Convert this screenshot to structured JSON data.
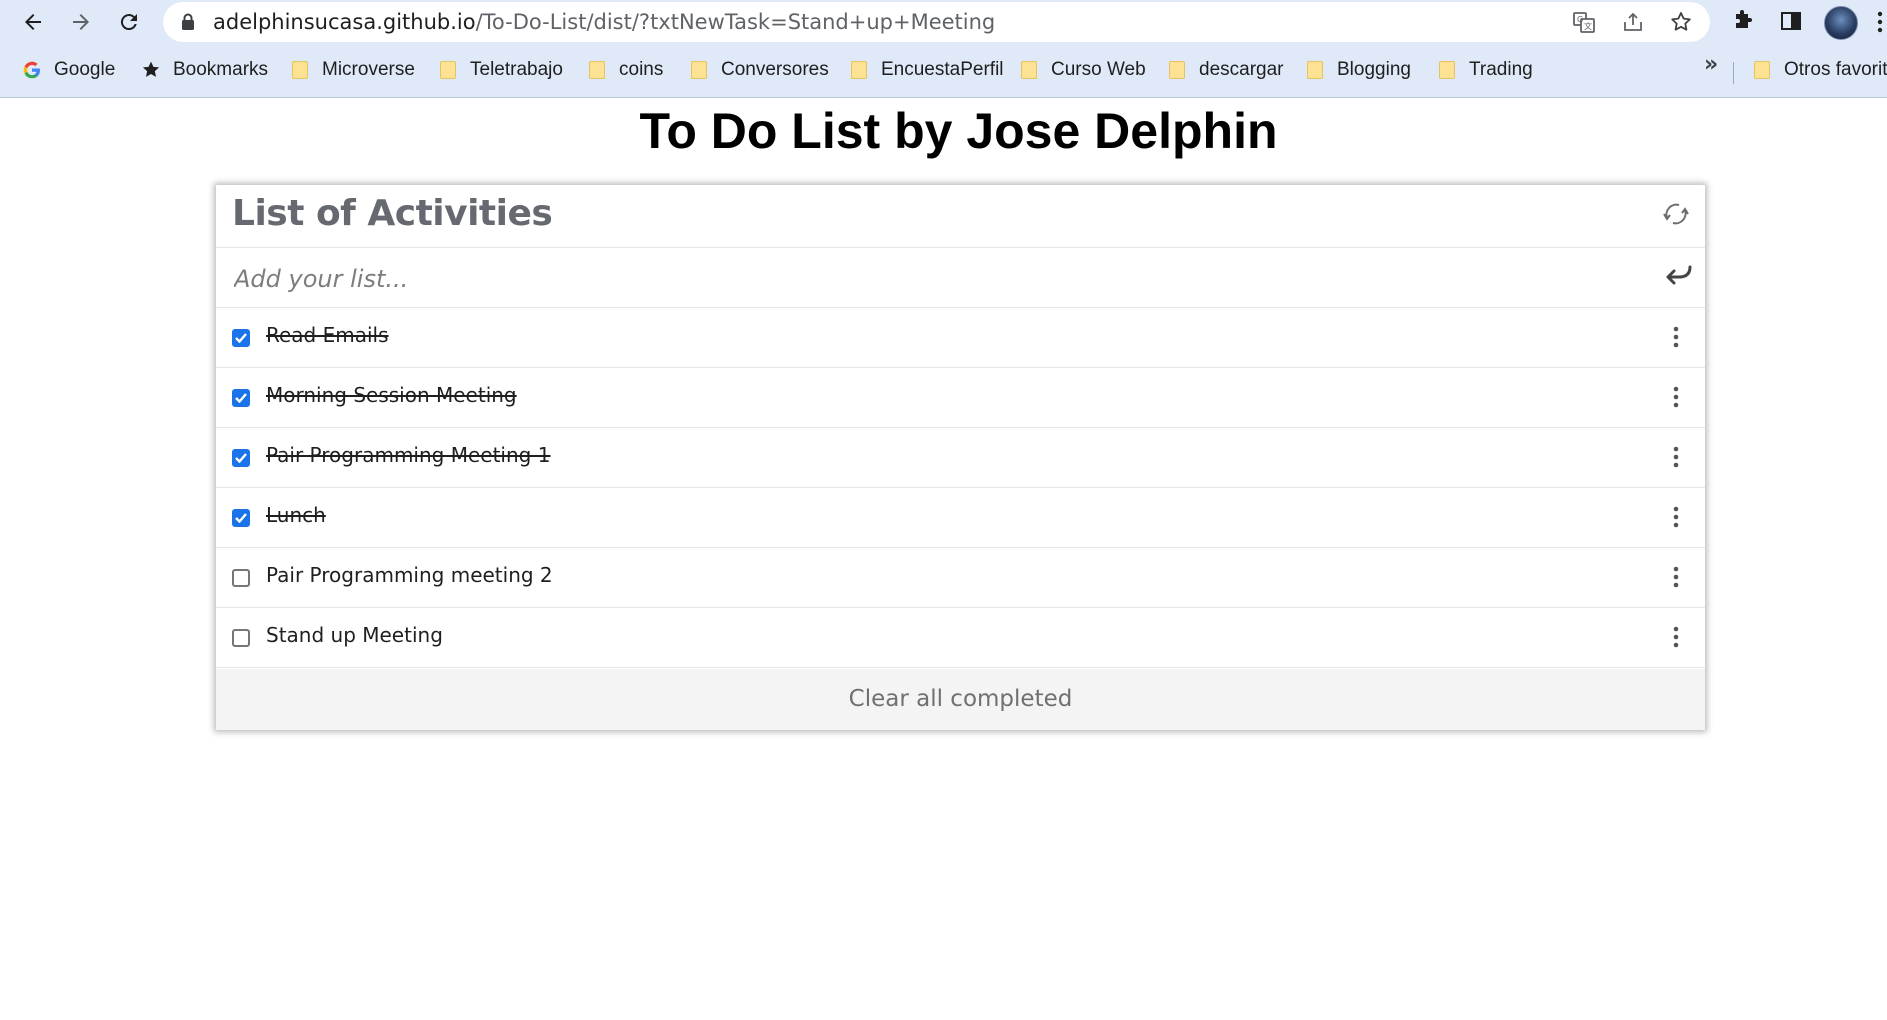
{
  "browser": {
    "url_host": "adelphinsucasa.github.io",
    "url_path": "/To-Do-List/dist/?txtNewTask=Stand+up+Meeting",
    "bookmarks": [
      {
        "label": "Google",
        "icon": "google-icon"
      },
      {
        "label": "Bookmarks",
        "icon": "star-icon"
      },
      {
        "label": "Microverse",
        "icon": "folder-icon"
      },
      {
        "label": "Teletrabajo",
        "icon": "folder-icon"
      },
      {
        "label": "coins",
        "icon": "folder-icon"
      },
      {
        "label": "Conversores",
        "icon": "folder-icon"
      },
      {
        "label": "EncuestaPerfil",
        "icon": "folder-icon"
      },
      {
        "label": "Curso Web",
        "icon": "folder-icon"
      },
      {
        "label": "descargar",
        "icon": "folder-icon"
      },
      {
        "label": "Blogging",
        "icon": "folder-icon"
      },
      {
        "label": "Trading",
        "icon": "folder-icon"
      }
    ],
    "more_bookmarks": "»",
    "other_bookmarks": "Otros favorit"
  },
  "page": {
    "title": "To Do List by Jose Delphin"
  },
  "todo": {
    "header": "List of Activities",
    "input_placeholder": "Add your list...",
    "tasks": [
      {
        "label": "Read Emails",
        "completed": true
      },
      {
        "label": "Morning Session Meeting",
        "completed": true
      },
      {
        "label": "Pair Programming Meeting 1",
        "completed": true
      },
      {
        "label": "Lunch",
        "completed": true
      },
      {
        "label": "Pair Programming meeting 2",
        "completed": false
      },
      {
        "label": "Stand up Meeting",
        "completed": false
      }
    ],
    "clear_label": "Clear all completed"
  },
  "colors": {
    "chrome_bg": "#dfe9f8",
    "checkbox_accent": "#1a73e8",
    "header_text": "#666a70",
    "footer_bg": "#f4f4f4"
  }
}
